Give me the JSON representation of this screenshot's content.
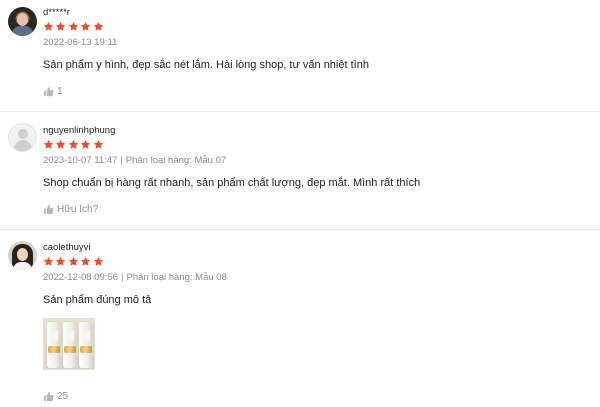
{
  "colors": {
    "star": "#ee4d2d",
    "meta": "#8a8a8a",
    "like": "#8c8c8c"
  },
  "icons": {
    "rating": "star-icon",
    "like": "thumbs-up-icon"
  },
  "reviews": [
    {
      "username": "d*****r",
      "rating": 5,
      "date": "2022-06-13 19:11",
      "variation": "",
      "content": "Sản phẩm y hình, đẹp sắc nét lắm. Hài lòng shop, tư vấn nhiệt tình",
      "likes": "1"
    },
    {
      "username": "nguyenlinhphung",
      "rating": 5,
      "date": "2023-10-07 11:47",
      "separator": "|",
      "variation": "Phân loại hàng: Mẫu 07",
      "content": "Shop chuẩn bị hàng rất nhanh, sản phẩm chất lượng, đẹp mắt. Mình rất thích",
      "likes": "Hữu Ích?"
    },
    {
      "username": "caolethuyvi",
      "rating": 5,
      "date": "2022-12-08 09:56",
      "separator": "|",
      "variation": "Phân loại hàng: Mẫu 08",
      "content": "Sản phẩm đúng mô tả",
      "likes": "25"
    }
  ]
}
